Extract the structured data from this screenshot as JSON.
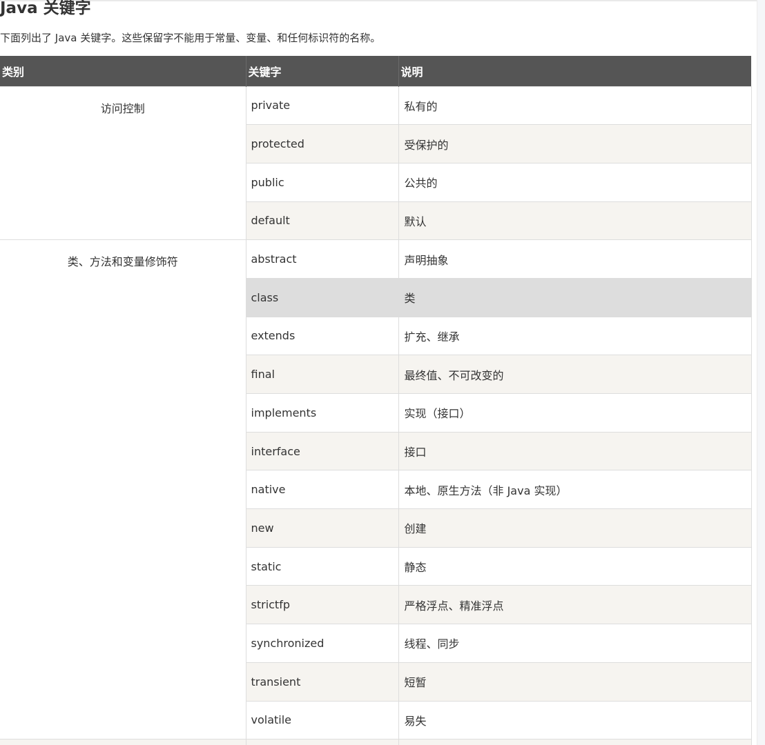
{
  "page": {
    "title": "Java 关键字",
    "intro": "下面列出了 Java 关键字。这些保留字不能用于常量、变量、和任何标识符的名称。"
  },
  "table": {
    "headers": [
      "类别",
      "关键字",
      "说明"
    ],
    "groups": [
      {
        "category": "访问控制",
        "rows": [
          {
            "keyword": "private",
            "desc": "私有的"
          },
          {
            "keyword": "protected",
            "desc": "受保护的"
          },
          {
            "keyword": "public",
            "desc": "公共的"
          },
          {
            "keyword": "default",
            "desc": "默认"
          }
        ]
      },
      {
        "category": "类、方法和变量修饰符",
        "rows": [
          {
            "keyword": "abstract",
            "desc": "声明抽象"
          },
          {
            "keyword": "class",
            "desc": "类"
          },
          {
            "keyword": "extends",
            "desc": "扩充、继承"
          },
          {
            "keyword": "final",
            "desc": "最终值、不可改变的"
          },
          {
            "keyword": "implements",
            "desc": "实现（接口）"
          },
          {
            "keyword": "interface",
            "desc": "接口"
          },
          {
            "keyword": "native",
            "desc": "本地、原生方法（非 Java 实现）"
          },
          {
            "keyword": "new",
            "desc": "创建"
          },
          {
            "keyword": "static",
            "desc": "静态"
          },
          {
            "keyword": "strictfp",
            "desc": "严格浮点、精准浮点"
          },
          {
            "keyword": "synchronized",
            "desc": "线程、同步"
          },
          {
            "keyword": "transient",
            "desc": "短暂"
          },
          {
            "keyword": "volatile",
            "desc": "易失"
          }
        ]
      }
    ]
  },
  "colors": {
    "header_bg": "#555555",
    "header_text": "#ffffff",
    "row_alt_bg": "#f6f4f0",
    "row_hover_bg": "#dddddd",
    "border": "#dddddd"
  }
}
